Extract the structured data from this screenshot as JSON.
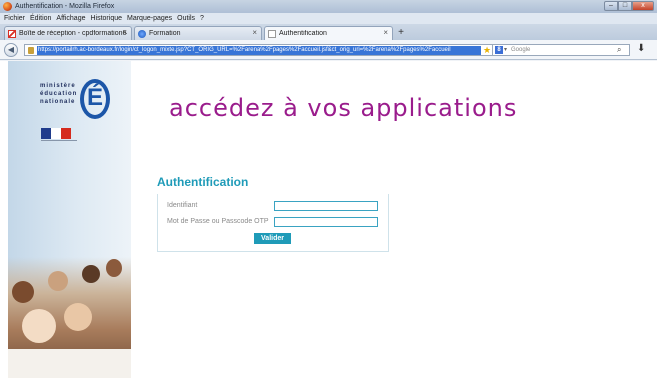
{
  "window": {
    "title": "Authentification - Mozilla Firefox",
    "controls": {
      "minimize": "–",
      "maximize": "□",
      "close": "x"
    }
  },
  "menu": {
    "items": [
      "Fichier",
      "Édition",
      "Affichage",
      "Historique",
      "Marque-pages",
      "Outils",
      "?"
    ]
  },
  "tabs": [
    {
      "label": "Boîte de réception - cpdformation64...",
      "close": "×",
      "icon": "gmail-icon"
    },
    {
      "label": "Formation",
      "close": "×",
      "icon": "formation-icon"
    },
    {
      "label": "Authentification",
      "close": "×",
      "icon": "page-icon"
    }
  ],
  "new_tab_label": "+",
  "nav": {
    "back": "◀",
    "url": "https://portailrh.ac-bordeaux.fr/login/ct_logon_mixte.jsp?CT_ORIG_URL=%2Farena%2Fpages%2Faccueil.jsf&ct_orig_uri=%2Farena%2Fpages%2Faccueil",
    "star": "★",
    "dropdown": "▼",
    "reload": "C",
    "search_engine": "8",
    "search_dropdown": "▾",
    "search_placeholder": "Google",
    "search_icon_glyph": "⌕",
    "download_glyph": "⬇"
  },
  "sidebar": {
    "ministry_lines": [
      "ministère",
      "éducation",
      "nationale"
    ],
    "logo_letter": "É",
    "flag_colors": [
      "#1f3c8c",
      "#ffffff",
      "#d52b1e"
    ]
  },
  "page": {
    "banner": "accédez à vos applications",
    "auth_title": "Authentification",
    "fields": [
      {
        "label": "Identifiant",
        "value": ""
      },
      {
        "label": "Mot de Passe ou Passcode OTP",
        "value": ""
      }
    ],
    "submit_label": "Valider"
  }
}
